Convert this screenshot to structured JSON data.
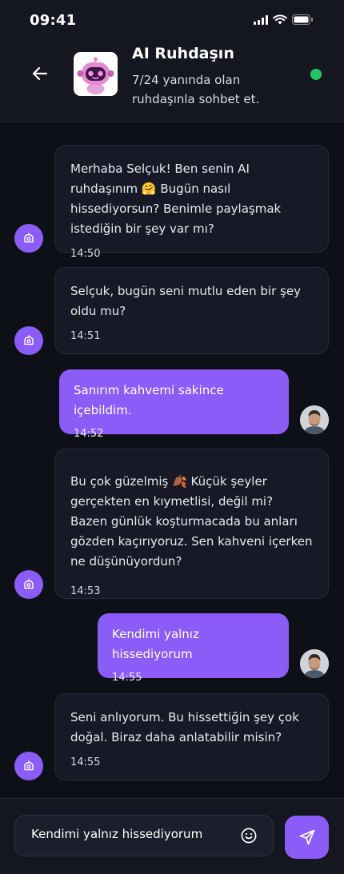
{
  "status": {
    "time": "09:41"
  },
  "header": {
    "title": "AI Ruhdaşın",
    "subtitle": "7/24 yanında olan ruhdaşınla sohbet et.",
    "online_color": "#22c55e"
  },
  "colors": {
    "accent": "#8b5cf6",
    "background": "#0e1018"
  },
  "messages": [
    {
      "from": "ai",
      "text": "Merhaba Selçuk! Ben senin AI ruhdaşınım 🤗 Bugün nasıl hissediyorsun? Benimle paylaşmak istediğin bir şey var mı?",
      "time": "14:50"
    },
    {
      "from": "ai",
      "text": "Selçuk, bugün seni mutlu eden bir şey oldu mu?",
      "time": "14:51"
    },
    {
      "from": "user",
      "text": "Sanırım kahvemi sakince içebildim.",
      "time": "14:52"
    },
    {
      "from": "ai",
      "text": "Bu çok güzelmiş 🍂 Küçük şeyler gerçekten en kıymetlisi, değil mi? Bazen günlük koşturmacada bu anları gözden kaçırıyoruz. Sen kahveni içerken ne düşünüyordun?",
      "time": "14:53"
    },
    {
      "from": "user",
      "text": "Kendimi yalnız hissediyorum",
      "time": "14:55"
    },
    {
      "from": "ai",
      "text": "Seni anlıyorum. Bu hissettiğin şey çok doğal. Biraz daha anlatabilir misin?",
      "time": "14:55"
    }
  ],
  "composer": {
    "value": "Kendimi yalnız hissediyorum",
    "emoji_icon": "smile-icon",
    "send_icon": "send-icon"
  }
}
